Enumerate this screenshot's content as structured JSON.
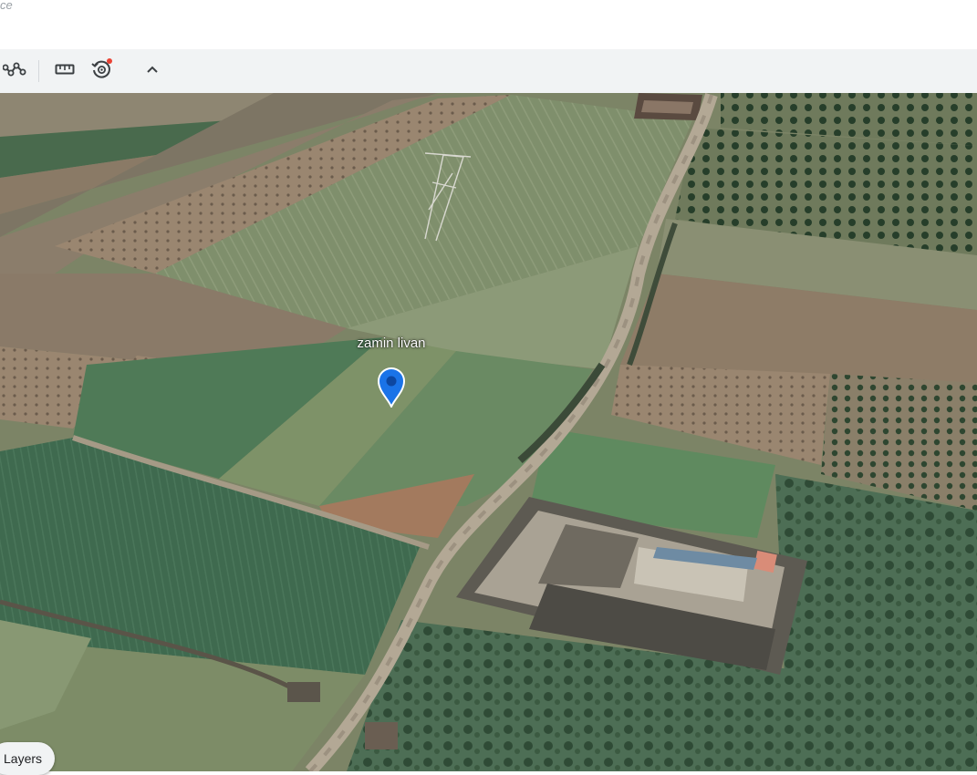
{
  "search": {
    "cut_text": "ce"
  },
  "toolbar": {
    "buttons": [
      {
        "icon": "path-measure-icon",
        "label": ""
      },
      {
        "icon": "ruler-icon",
        "label": ""
      },
      {
        "icon": "history-icon",
        "label": "",
        "notification": true
      },
      {
        "icon": "chevron-up-icon",
        "label": ""
      }
    ],
    "notification_color": "#ea4335"
  },
  "map": {
    "view": "3D satellite",
    "place_label": "zamin livan",
    "pin_color": "#1a73e8"
  },
  "layers_button": {
    "label": "Layers"
  }
}
